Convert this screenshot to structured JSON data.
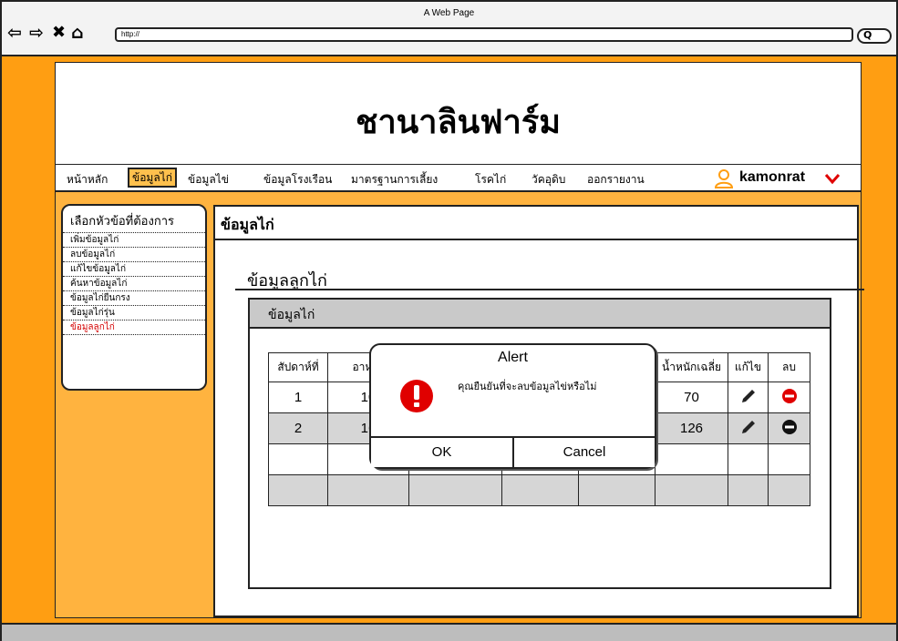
{
  "window": {
    "title": "A Web Page",
    "url": "http://"
  },
  "colors": {
    "page_bg": "#ff9e12",
    "accent": "#ffb33f",
    "header_gray": "#c9c9c9",
    "alert_red": "#e00000"
  },
  "header": {
    "site_title": "ชานาลินฟาร์ม"
  },
  "menu": {
    "items": [
      "หน้าหลัก",
      "ข้อมูลไก่",
      "ข้อมูลไข่",
      "ข้อมูลโรงเรือน",
      "มาตรฐานการเลี้ยง",
      "โรคไก่",
      "วัคอุดิบ",
      "ออกรายงาน"
    ],
    "active_index": 1,
    "user": "kamonrat"
  },
  "sidebar": {
    "heading": "เลือกหัวข้อที่ต้องการ",
    "items": [
      "เพิ่มข้อมูลไก่",
      "ลบข้อมูลไก่",
      "แก้ไขข้อมูลไก่",
      "ค้นหาข้อมูลไก่",
      "ข้อมูลไก่ยืนกรง",
      "ข้อมูลไก่รุ่น",
      "ข้อมูลลูกไก่"
    ],
    "active_index": 6
  },
  "main": {
    "title": "ข้อมูลไก่",
    "section_title": "ข้อมูลลูกไก่",
    "panel_title": "ข้อมูลไก่"
  },
  "table": {
    "headers": [
      "สัปดาห์ที่",
      "อาหาร",
      "",
      "",
      "",
      "น้ำหนักเฉลี่ย",
      "แก้ไข",
      "ลบ"
    ],
    "rows": [
      [
        "1",
        "10",
        "",
        "",
        "",
        "70"
      ],
      [
        "2",
        "16",
        "",
        "",
        "",
        "126"
      ]
    ]
  },
  "dialog": {
    "title": "Alert",
    "message": "คุณยืนยันที่จะลบข้อมูลไข่หรือไม่",
    "ok_label": "OK",
    "cancel_label": "Cancel"
  }
}
